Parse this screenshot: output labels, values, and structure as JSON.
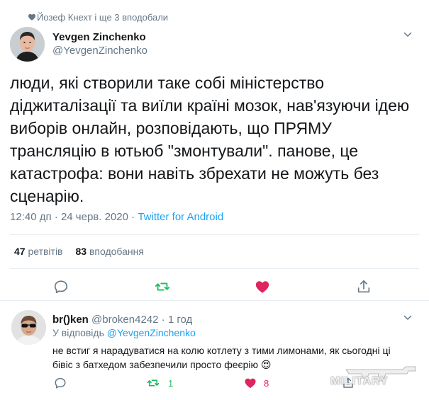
{
  "social_context": "Йозеф Кнехт і ще 3 вподобали",
  "tweet": {
    "author_name": "Yevgen Zinchenko",
    "author_handle": "@YevgenZinchenko",
    "text_lines": [
      "люди, які створили таке собі міністерство",
      "діджиталізації та виїли країні мозок, нав'язуючи ідею",
      "виборів онлайн, розповідають, що ПРЯМУ",
      "трансляцію в ютьюб \"змонтували\". панове, це",
      "катастрофа: вони навіть збрехати не можуть без",
      "сценарію."
    ],
    "time": "12:40 дп",
    "separator": "·",
    "date": "24 черв. 2020",
    "source": "Twitter for Android",
    "retweets_count": "47",
    "retweets_label": "ретвітів",
    "likes_count": "83",
    "likes_label": "вподобання",
    "liked": true
  },
  "reply": {
    "author_name": "br()ken",
    "author_handle": "@broken4242",
    "separator": "·",
    "time": "1 год",
    "replying_to_label": "У відповідь",
    "replying_to_handle": "@YevgenZinchenko",
    "text_lines": [
      "не встиг я нарадуватися на колю котлету з тими лимонами, як сьогодні ці",
      "бівіс з батхедом забезпечили просто феєрію 😍"
    ],
    "retweets_count": "1",
    "likes_count": "8"
  },
  "watermark": "MILITARY",
  "colors": {
    "accent": "#1da1f2",
    "retweet_green": "#17bf63",
    "like_red": "#e0245e",
    "secondary_text": "#657786",
    "divider": "#e6ecf0"
  }
}
